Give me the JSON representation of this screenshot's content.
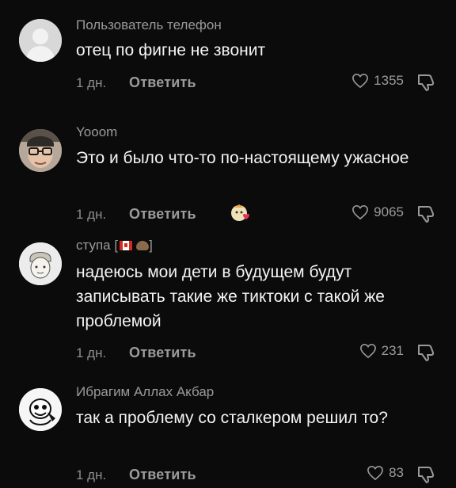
{
  "comments": [
    {
      "author": "Пользователь телефон",
      "text": "отец по фигне не звонит",
      "time": "1 дн.",
      "reply_label": "Ответить",
      "likes": "1355"
    },
    {
      "author": "Yooom",
      "text": "Это и было что-то по-настоящему ужасное",
      "time": "1 дн.",
      "reply_label": "Ответить",
      "likes": "9065"
    },
    {
      "author": "ступа",
      "author_suffix_open": "[",
      "author_suffix_close": "]",
      "text": "надеюсь мои дети в будущем будут записывать такие же тиктоки с такой же проблемой",
      "time": "1 дн.",
      "reply_label": "Ответить",
      "likes": "231"
    },
    {
      "author": "Ибрагим Аллах Акбар",
      "text": "так а проблему со сталкером решил то?",
      "time": "1 дн.",
      "reply_label": "Ответить",
      "likes": "83"
    }
  ],
  "icons": {
    "like": "heart-outline-icon",
    "dislike": "thumbs-down-icon"
  },
  "colors": {
    "background": "#0b0b0b",
    "text_primary": "#f4f4f4",
    "text_secondary": "#9a9a9a",
    "heart_red": "#e6335a"
  }
}
